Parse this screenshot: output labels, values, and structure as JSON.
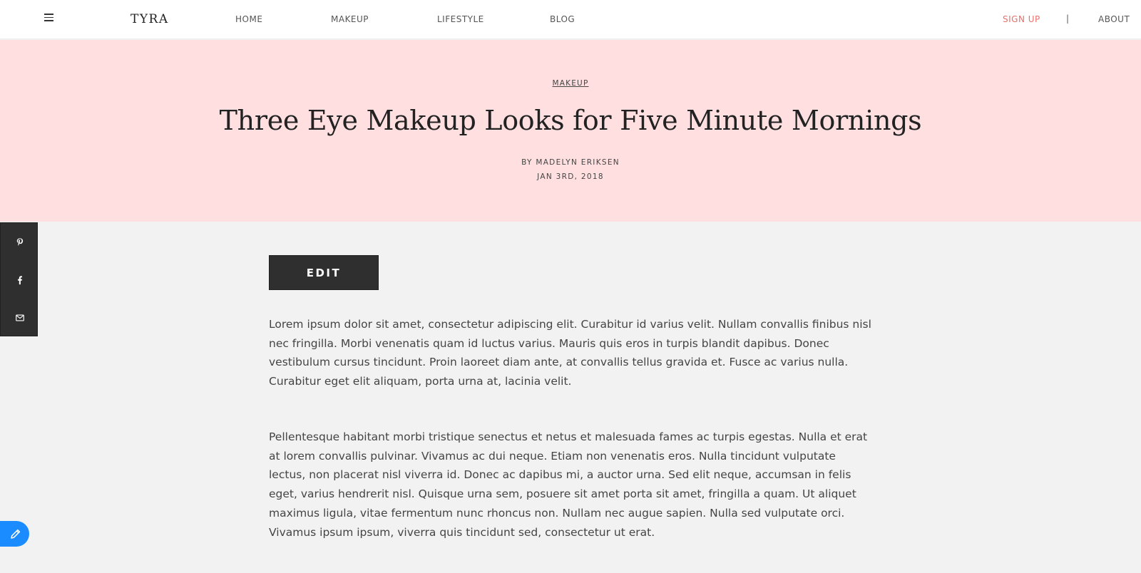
{
  "nav": {
    "logo": "TYRA",
    "links": [
      "HOME",
      "MAKEUP",
      "LIFESTYLE",
      "BLOG"
    ],
    "signup": "SIGN UP",
    "separator": "|",
    "about": "ABOUT"
  },
  "hero": {
    "category": "MAKEUP",
    "title": "Three Eye Makeup Looks for Five Minute Mornings",
    "byline": "BY MADELYN ERIKSEN",
    "date": "JAN 3RD, 2018",
    "background_color": "#ffdfe0"
  },
  "share": {
    "items": [
      "pinterest-icon",
      "facebook-icon",
      "mail-icon"
    ]
  },
  "content": {
    "edit_label": "EDIT",
    "paragraphs": [
      "Lorem ipsum dolor sit amet, consectetur adipiscing elit. Curabitur id varius velit. Nullam convallis finibus nisl nec fringilla. Morbi venenatis quam id luctus varius. Mauris quis eros in turpis blandit dapibus. Donec vestibulum cursus tincidunt. Proin laoreet diam ante, at convallis tellus gravida et. Fusce ac varius nulla. Curabitur eget elit aliquam, porta urna at, lacinia velit.",
      "Pellentesque habitant morbi tristique senectus et netus et malesuada fames ac turpis egestas. Nulla et erat at lorem convallis pulvinar. Vivamus ac dui neque. Etiam non venenatis eros. Nulla tincidunt vulputate lectus, non placerat nisl viverra id. Donec ac dapibus mi, a auctor urna. Sed elit neque, accumsan in felis eget, varius hendrerit nisl. Quisque urna sem, posuere sit amet porta sit amet, fringilla a quam. Ut aliquet maximus ligula, vitae fermentum nunc rhoncus non. Nullam nec augue sapien. Nulla sed vulputate orci. Vivamus ipsum ipsum, viverra quis tincidunt sed, consectetur ut erat."
    ]
  },
  "colors": {
    "accent_signup": "#e8706a",
    "dark_button": "#2f2f2f",
    "fab": "#1a8cff"
  }
}
